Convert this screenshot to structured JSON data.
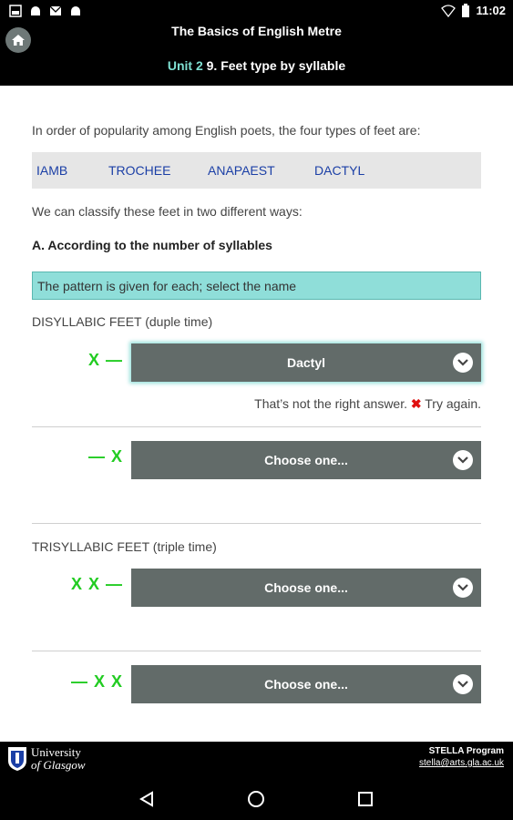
{
  "status_bar": {
    "time": "11:02",
    "icons_left": [
      "image-icon",
      "android-icon",
      "mail-icon",
      "android-icon"
    ],
    "icons_right": [
      "wifi-icon",
      "battery-icon"
    ]
  },
  "header": {
    "title": "The Basics of English Metre",
    "unit": "Unit 2",
    "subtitle": "9. Feet type by syllable"
  },
  "intro": "In order of popularity among English poets, the four types of feet are:",
  "feet": [
    "IAMB",
    "TROCHEE",
    "ANAPAEST",
    "DACTYL"
  ],
  "classify": "We can classify these feet in two different ways:",
  "section_a": "A. According to the number of syllables",
  "instruction": "The pattern is given for each; select the name",
  "disyllabic_label": "DISYLLABIC FEET (duple time)",
  "trisyllabic_label": "TRISYLLABIC FEET (triple time)",
  "questions": [
    {
      "pattern": "X —",
      "selected": "Dactyl"
    },
    {
      "pattern": "— X",
      "selected": "Choose one..."
    },
    {
      "pattern": "X X —",
      "selected": "Choose one..."
    },
    {
      "pattern": "— X X",
      "selected": "Choose one..."
    }
  ],
  "feedback": {
    "before": "That’s not the right answer.",
    "mark": "✖",
    "after": "Try again."
  },
  "footer": {
    "university_line1": "University",
    "university_line2": "of Glasgow",
    "program": "STELLA Program",
    "email": "stella@arts.gla.ac.uk"
  },
  "colors": {
    "accent_teal": "#8fded9",
    "select_bg": "#626b69",
    "pattern_green": "#22cc22",
    "link_blue": "#1b3fa6",
    "error_red": "#e01010"
  }
}
